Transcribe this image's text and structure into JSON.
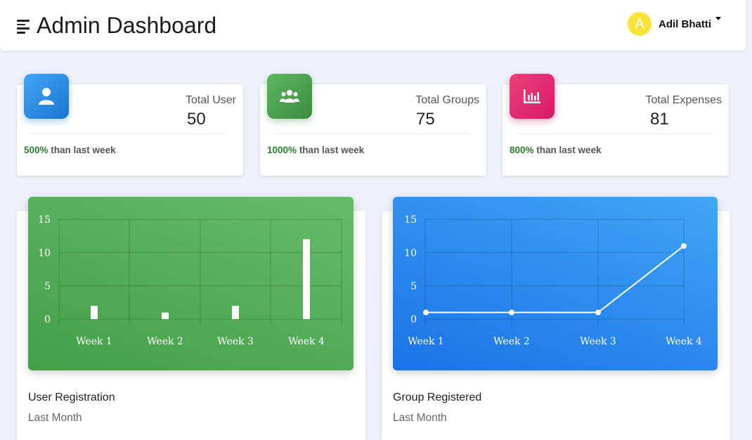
{
  "header": {
    "title": "Admin Dashboard",
    "user": {
      "initial": "A",
      "name": "Adil Bhatti"
    }
  },
  "stats": [
    {
      "label": "Total User",
      "value": "50",
      "pct": "500%",
      "note": "than last week",
      "icon": "user-icon",
      "color": "#2f80ed"
    },
    {
      "label": "Total Groups",
      "value": "75",
      "pct": "1000%",
      "note": "than last week",
      "icon": "users-group-icon",
      "color": "#47a74b"
    },
    {
      "label": "Total Expenses",
      "value": "81",
      "pct": "800%",
      "note": "than last week",
      "icon": "chart-bar-icon",
      "color": "#e91e63"
    }
  ],
  "charts": [
    {
      "title": "User Registration",
      "subtitle": "Last Month"
    },
    {
      "title": "Group Registered",
      "subtitle": "Last Month"
    }
  ],
  "chart_data": [
    {
      "type": "bar",
      "categories": [
        "Week 1",
        "Week 2",
        "Week 3",
        "Week 4"
      ],
      "values": [
        2,
        1,
        2,
        12
      ],
      "ylim": [
        0,
        15
      ],
      "yticks": [
        0,
        5,
        10,
        15
      ],
      "grid": true,
      "background": "#4caf50",
      "mark_color": "#ffffff"
    },
    {
      "type": "line",
      "categories": [
        "Week 1",
        "Week 2",
        "Week 3",
        "Week 4"
      ],
      "values": [
        1,
        1,
        1,
        11
      ],
      "ylim": [
        0,
        15
      ],
      "yticks": [
        0,
        5,
        10,
        15
      ],
      "grid": true,
      "background": "#2f80ed",
      "mark_color": "#ffffff"
    }
  ]
}
